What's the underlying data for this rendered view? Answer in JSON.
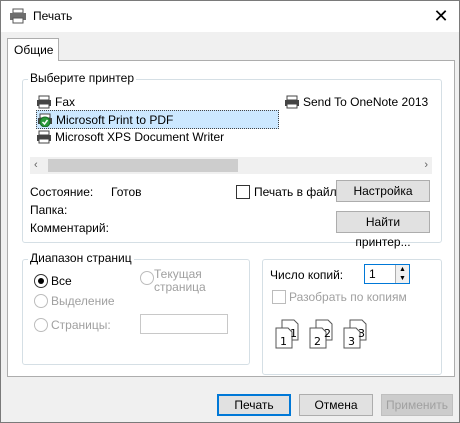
{
  "window": {
    "title": "Печать",
    "close_icon": "close-icon"
  },
  "tabs": [
    {
      "label": "Общие"
    }
  ],
  "printer_group": {
    "legend": "Выберите принтер",
    "printers": [
      {
        "name": "Fax",
        "icon": "printer-icon"
      },
      {
        "name": "Send To OneNote 2013",
        "icon": "printer-icon"
      },
      {
        "name": "Microsoft Print to PDF",
        "icon": "default-printer-icon",
        "selected": true
      },
      {
        "name": "Microsoft XPS Document Writer",
        "icon": "printer-icon"
      }
    ],
    "status_label": "Состояние:",
    "status_value": "Готов",
    "folder_label": "Папка:",
    "comment_label": "Комментарий:",
    "print_to_file_label": "Печать в файл",
    "settings_button": "Настройка",
    "find_printer_button": "Найти принтер..."
  },
  "range_group": {
    "legend": "Диапазон страниц",
    "all_label": "Все",
    "selection_label": "Выделение",
    "current_page_label_1": "Текущая",
    "current_page_label_2": "страница",
    "pages_label": "Страницы:",
    "pages_value": ""
  },
  "copies_group": {
    "copies_label": "Число копий:",
    "copies_value": "1",
    "collate_label": "Разобрать по копиям",
    "collate_digits": [
      "1",
      "1",
      "2",
      "2",
      "3",
      "3"
    ]
  },
  "footer": {
    "print_button": "Печать",
    "cancel_button": "Отмена",
    "apply_button": "Применить"
  }
}
